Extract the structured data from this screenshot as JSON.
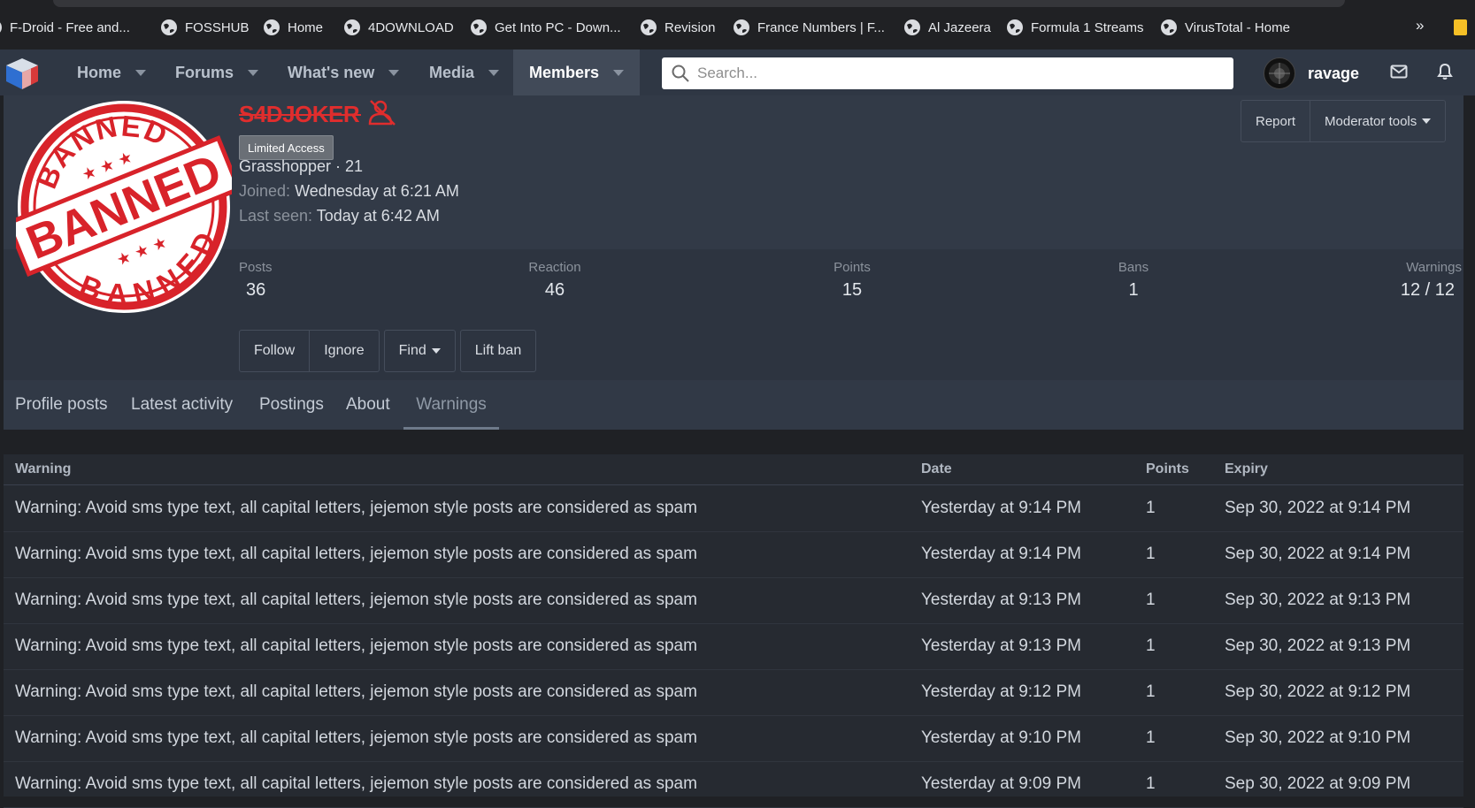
{
  "bookmarks": [
    {
      "label": "F-Droid - Free and..."
    },
    {
      "label": "FOSSHUB"
    },
    {
      "label": "Home"
    },
    {
      "label": "4DOWNLOAD"
    },
    {
      "label": "Get Into PC - Down..."
    },
    {
      "label": "Revision"
    },
    {
      "label": "France Numbers | F..."
    },
    {
      "label": "Al Jazeera"
    },
    {
      "label": "Formula 1 Streams"
    },
    {
      "label": "VirusTotal - Home"
    }
  ],
  "bookmarks_more": "»",
  "nav": {
    "tabs": [
      {
        "label": "Home"
      },
      {
        "label": "Forums"
      },
      {
        "label": "What's new"
      },
      {
        "label": "Media"
      },
      {
        "label": "Members"
      }
    ],
    "search_placeholder": "Search...",
    "username": "ravage"
  },
  "profile": {
    "username": "S4DJOKER",
    "badge": "Limited Access",
    "title_line": "Grasshopper · 21",
    "joined_label": "Joined:",
    "joined_value": "Wednesday at 6:21 AM",
    "last_seen_label": "Last seen:",
    "last_seen_value": "Today at 6:42 AM",
    "report_label": "Report",
    "moderator_tools_label": "Moderator tools",
    "stats": [
      {
        "label": "Posts",
        "value": "36"
      },
      {
        "label": "Reaction",
        "value": "46"
      },
      {
        "label": "Points",
        "value": "15"
      },
      {
        "label": "Bans",
        "value": "1"
      },
      {
        "label": "Warnings",
        "value": "12 / 12"
      }
    ],
    "actions": [
      {
        "label": "Follow"
      },
      {
        "label": "Ignore"
      },
      {
        "label": "Find"
      },
      {
        "label": "Lift ban"
      }
    ],
    "tabs": [
      {
        "label": "Profile posts"
      },
      {
        "label": "Latest activity"
      },
      {
        "label": "Postings"
      },
      {
        "label": "About"
      },
      {
        "label": "Warnings"
      }
    ],
    "active_tab": "Warnings"
  },
  "warnings_table": {
    "headers": {
      "warning": "Warning",
      "date": "Date",
      "points": "Points",
      "expiry": "Expiry"
    },
    "rows": [
      {
        "warning": "Warning: Avoid sms type text, all capital letters, jejemon style posts are considered as spam",
        "date": "Yesterday at 9:14 PM",
        "points": "1",
        "expiry": "Sep 30, 2022 at 9:14 PM"
      },
      {
        "warning": "Warning: Avoid sms type text, all capital letters, jejemon style posts are considered as spam",
        "date": "Yesterday at 9:14 PM",
        "points": "1",
        "expiry": "Sep 30, 2022 at 9:14 PM"
      },
      {
        "warning": "Warning: Avoid sms type text, all capital letters, jejemon style posts are considered as spam",
        "date": "Yesterday at 9:13 PM",
        "points": "1",
        "expiry": "Sep 30, 2022 at 9:13 PM"
      },
      {
        "warning": "Warning: Avoid sms type text, all capital letters, jejemon style posts are considered as spam",
        "date": "Yesterday at 9:13 PM",
        "points": "1",
        "expiry": "Sep 30, 2022 at 9:13 PM"
      },
      {
        "warning": "Warning: Avoid sms type text, all capital letters, jejemon style posts are considered as spam",
        "date": "Yesterday at 9:12 PM",
        "points": "1",
        "expiry": "Sep 30, 2022 at 9:12 PM"
      },
      {
        "warning": "Warning: Avoid sms type text, all capital letters, jejemon style posts are considered as spam",
        "date": "Yesterday at 9:10 PM",
        "points": "1",
        "expiry": "Sep 30, 2022 at 9:10 PM"
      },
      {
        "warning": "Warning: Avoid sms type text, all capital letters, jejemon style posts are considered as spam",
        "date": "Yesterday at 9:09 PM",
        "points": "1",
        "expiry": "Sep 30, 2022 at 9:09 PM"
      }
    ]
  },
  "banned_stamp": {
    "top_text": "BANNED",
    "center_text": "BANNED",
    "bottom_text": "BANNED",
    "color": "#d8232a"
  },
  "colors": {
    "nav_bg": "#2f3744",
    "nav_active": "#414a58",
    "banned_red": "#e02d2d",
    "page_bg": "#1f2125"
  }
}
